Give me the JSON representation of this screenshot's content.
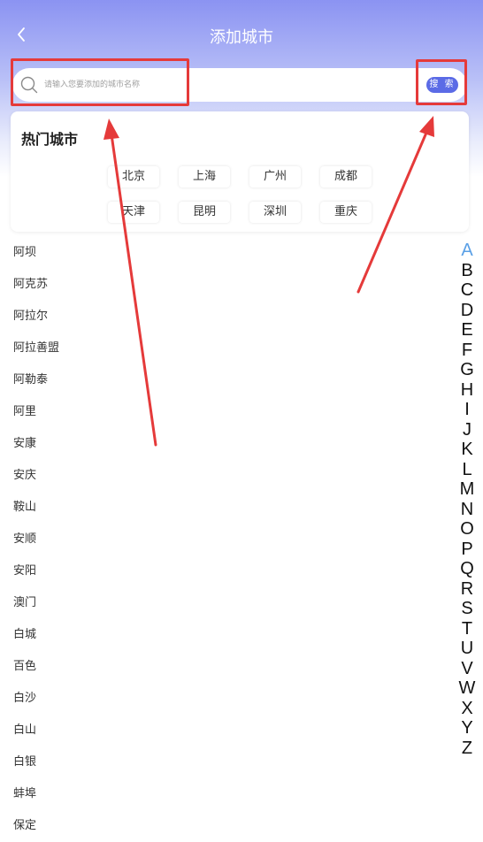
{
  "header": {
    "title": "添加城市",
    "back_icon": "chevron-left-icon"
  },
  "search": {
    "placeholder": "请输入您要添加的城市名称",
    "value": "",
    "button_label": "搜 索",
    "icon": "search-icon"
  },
  "hot_cities": {
    "title": "热门城市",
    "items": [
      "北京",
      "上海",
      "广州",
      "成都",
      "天津",
      "昆明",
      "深圳",
      "重庆"
    ]
  },
  "city_list": [
    "阿坝",
    "阿克苏",
    "阿拉尔",
    "阿拉善盟",
    "阿勒泰",
    "阿里",
    "安康",
    "安庆",
    "鞍山",
    "安顺",
    "安阳",
    "澳门",
    "白城",
    "百色",
    "白沙",
    "白山",
    "白银",
    "蚌埠",
    "保定"
  ],
  "index_letters": [
    "A",
    "B",
    "C",
    "D",
    "E",
    "F",
    "G",
    "H",
    "I",
    "J",
    "K",
    "L",
    "M",
    "N",
    "O",
    "P",
    "Q",
    "R",
    "S",
    "T",
    "U",
    "V",
    "W",
    "X",
    "Y",
    "Z"
  ],
  "active_letter": "A",
  "colors": {
    "accent": "#5b6be6",
    "header_top": "#8b93f2",
    "annotation": "#e53a3a",
    "active_letter": "#5aa0e6"
  }
}
